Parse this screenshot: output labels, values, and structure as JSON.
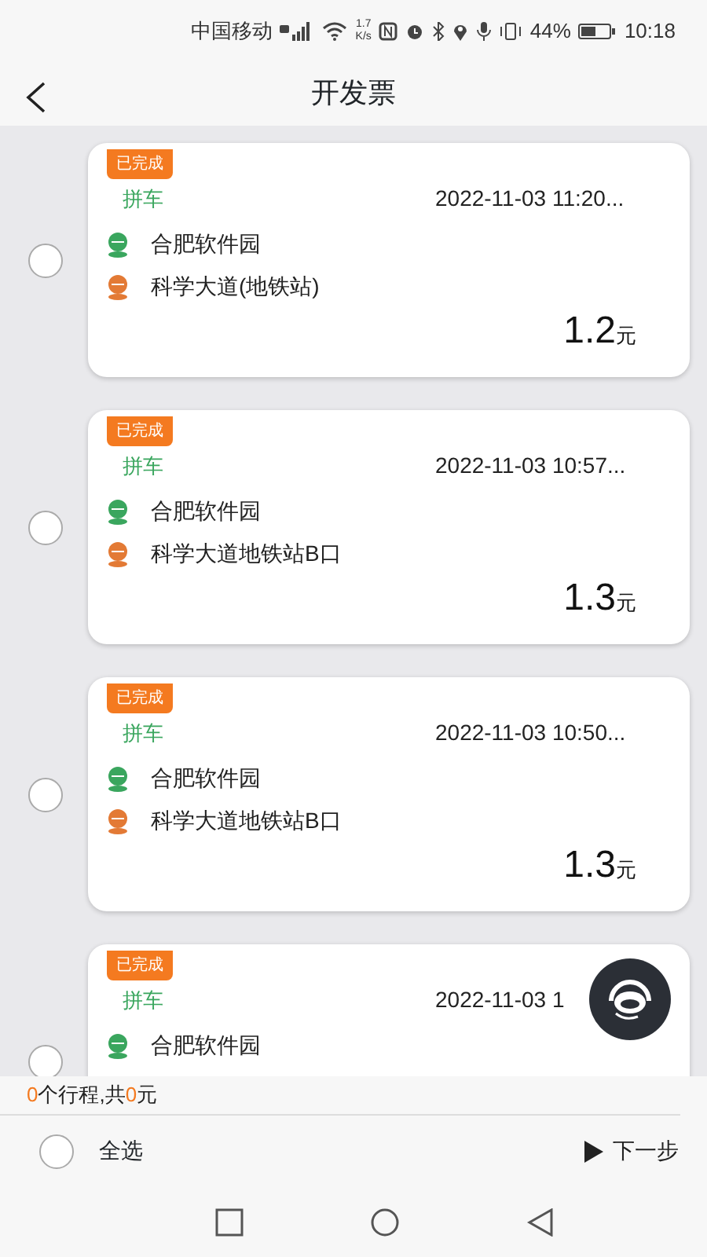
{
  "status_bar": {
    "carrier": "中国移动",
    "speed": "1.7\nK/s",
    "battery": "44%",
    "time": "10:18"
  },
  "header": {
    "title": "开发票"
  },
  "trips": [
    {
      "selected": false,
      "status": "已完成",
      "type": "拼车",
      "time": "2022-11-03 11:20...",
      "start": "合肥软件园",
      "end": "科学大道(地铁站)",
      "price": "1.2",
      "unit": "元"
    },
    {
      "selected": false,
      "status": "已完成",
      "type": "拼车",
      "time": "2022-11-03 10:57...",
      "start": "合肥软件园",
      "end": "科学大道地铁站B口",
      "price": "1.3",
      "unit": "元"
    },
    {
      "selected": false,
      "status": "已完成",
      "type": "拼车",
      "time": "2022-11-03 10:50...",
      "start": "合肥软件园",
      "end": "科学大道地铁站B口",
      "price": "1.3",
      "unit": "元"
    },
    {
      "selected": false,
      "status": "已完成",
      "type": "拼车",
      "time": "2022-11-03 1",
      "start": "合肥软件园"
    }
  ],
  "summary": {
    "count": "0",
    "count_suffix": "个行程,共",
    "total": "0",
    "total_suffix": "元"
  },
  "footer": {
    "select_all": {
      "label": "全选",
      "checked": false
    },
    "next": "下一步"
  }
}
